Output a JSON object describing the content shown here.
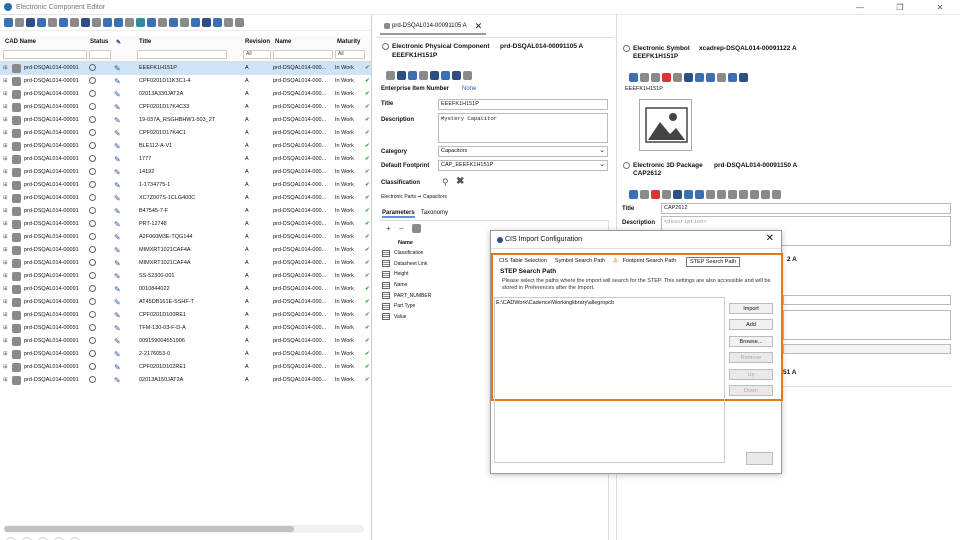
{
  "app": {
    "title": "Electronic Component Editor"
  },
  "left": {
    "columns": {
      "cad": "CAD Name",
      "status": "Status",
      "title": "Title",
      "revision": "Revision",
      "name": "Name",
      "maturity": "Maturity"
    },
    "filters": {
      "revision": "All",
      "maturity": "All"
    },
    "rows": [
      {
        "cad": "prd-DSQAL014-00091",
        "title": "EEEFK1H151P",
        "rev": "A",
        "name": "prd-DSQAL014-000...",
        "mat": "In Work"
      },
      {
        "cad": "prd-DSQAL014-00091",
        "title": "CPF0201D11K3C1-4",
        "rev": "A",
        "name": "prd-DSQAL014-000...",
        "mat": "In Work"
      },
      {
        "cad": "prd-DSQAL014-00091",
        "title": "02013A330JAT2A",
        "rev": "A",
        "name": "prd-DSQAL014-000...",
        "mat": "In Work"
      },
      {
        "cad": "prd-DSQAL014-00091",
        "title": "CPF0201D17K4C33",
        "rev": "A",
        "name": "prd-DSQAL014-000...",
        "mat": "In Work"
      },
      {
        "cad": "prd-DSQAL014-00091",
        "title": "19-037A_RSGHBHW1-503_2T",
        "rev": "A",
        "name": "prd-DSQAL014-000...",
        "mat": "In Work"
      },
      {
        "cad": "prd-DSQAL014-00091",
        "title": "CPF0201D17K4C1",
        "rev": "A",
        "name": "prd-DSQAL014-000...",
        "mat": "In Work"
      },
      {
        "cad": "prd-DSQAL014-00091",
        "title": "BLE112-A-V1",
        "rev": "A",
        "name": "prd-DSQAL014-000...",
        "mat": "In Work"
      },
      {
        "cad": "prd-DSQAL014-00091",
        "title": "1777",
        "rev": "A",
        "name": "prd-DSQAL014-000...",
        "mat": "In Work"
      },
      {
        "cad": "prd-DSQAL014-00091",
        "title": "14192",
        "rev": "A",
        "name": "prd-DSQAL014-000...",
        "mat": "In Work"
      },
      {
        "cad": "prd-DSQAL014-00091",
        "title": "1-1734775-1",
        "rev": "A",
        "name": "prd-DSQAL014-000...",
        "mat": "In Work"
      },
      {
        "cad": "prd-DSQAL014-00091",
        "title": "XC7Z007S-1CLG400C",
        "rev": "A",
        "name": "prd-DSQAL014-000...",
        "mat": "In Work"
      },
      {
        "cad": "prd-DSQAL014-00091",
        "title": "B47545-7-F",
        "rev": "A",
        "name": "prd-DSQAL014-000...",
        "mat": "In Work"
      },
      {
        "cad": "prd-DSQAL014-00091",
        "title": "PRT-12748",
        "rev": "A",
        "name": "prd-DSQAL014-000...",
        "mat": "In Work"
      },
      {
        "cad": "prd-DSQAL014-00091",
        "title": "A2F060M3E-TQG144",
        "rev": "A",
        "name": "prd-DSQAL014-000...",
        "mat": "In Work"
      },
      {
        "cad": "prd-DSQAL014-00091",
        "title": "MIMXRT1021CAF4A",
        "rev": "A",
        "name": "prd-DSQAL014-000...",
        "mat": "In Work"
      },
      {
        "cad": "prd-DSQAL014-00091",
        "title": "MIMXRT1021CAF4A",
        "rev": "A",
        "name": "prd-DSQAL014-000...",
        "mat": "In Work"
      },
      {
        "cad": "prd-DSQAL014-00091",
        "title": "SS-52300-001",
        "rev": "A",
        "name": "prd-DSQAL014-000...",
        "mat": "In Work"
      },
      {
        "cad": "prd-DSQAL014-00091",
        "title": "0010844022",
        "rev": "A",
        "name": "prd-DSQAL014-000...",
        "mat": "In Work"
      },
      {
        "cad": "prd-DSQAL014-00091",
        "title": "AT45DB161E-SSHF-T",
        "rev": "A",
        "name": "prd-DSQAL014-000...",
        "mat": "In Work"
      },
      {
        "cad": "prd-DSQAL014-00091",
        "title": "CPF0201D100RE1",
        "rev": "A",
        "name": "prd-DSQAL014-000...",
        "mat": "In Work"
      },
      {
        "cad": "prd-DSQAL014-00091",
        "title": "TFM-130-03-F-D-A",
        "rev": "A",
        "name": "prd-DSQAL014-000...",
        "mat": "In Work"
      },
      {
        "cad": "prd-DSQAL014-00091",
        "title": "009159004551906",
        "rev": "A",
        "name": "prd-DSQAL014-000...",
        "mat": "In Work"
      },
      {
        "cad": "prd-DSQAL014-00091",
        "title": "2-2176053-0",
        "rev": "A",
        "name": "prd-DSQAL014-000...",
        "mat": "In Work"
      },
      {
        "cad": "prd-DSQAL014-00091",
        "title": "CPF0201D102RE1",
        "rev": "A",
        "name": "prd-DSQAL014-000...",
        "mat": "In Work"
      },
      {
        "cad": "prd-DSQAL014-00091",
        "title": "02013A150JAT2A",
        "rev": "A",
        "name": "prd-DSQAL014-000...",
        "mat": "In Work"
      }
    ]
  },
  "mid": {
    "tab": "prd-DSQAL014-00091105 A",
    "header_type": "Electronic Physical Component",
    "header_id": "prd-DSQAL014-00091105 A",
    "header_sub": "EEEFK1H151P",
    "eii_label": "Enterprise Item Number",
    "eii_value": "None",
    "title_label": "Title",
    "title_value": "EEEFK1H151P",
    "desc_label": "Description",
    "desc_value": "Mystery Capacitor",
    "cat_label": "Category",
    "cat_value": "Capacitors",
    "fp_label": "Default Footprint",
    "fp_value": "CAP_EEEFK1H151P",
    "class_label": "Classification",
    "class_path": "Electronic Parts ➞ Capacitors",
    "ptabs": [
      "Parameters",
      "Taxonomy"
    ],
    "name_col": "Name",
    "params": [
      "Classification",
      "Datasheet Link",
      "Height",
      "Name",
      "PART_NUMBER",
      "Part Type",
      "Value"
    ]
  },
  "right": {
    "sym_type": "Electronic Symbol",
    "sym_id": "xcadrep-DSQAL014-00091122 A",
    "sym_sub": "EEEFK1H151P",
    "sym_name": "EEEFK1H151P",
    "pkg_type": "Electronic 3D Package",
    "pkg_id": "prd-DSQAL014-00091150 A",
    "pkg_sub": "CAP2612",
    "title_label": "Title",
    "title_value": "CAP2612",
    "desc_label": "Description",
    "desc_placeholder": "<description>",
    "frag1": "2 A",
    "frag2": "51 A"
  },
  "dialog": {
    "title": "CIS Import Configuration",
    "tabs": [
      "CIS Table Selection",
      "Symbol Search Path",
      "Footprint Search Path",
      "STEP Search Path"
    ],
    "heading": "STEP Search Path",
    "desc": "Please select the paths where the import will search for the STEP. This settings are also accessible and will be stored in Preferences after the Import.",
    "path": "E:\\CADWork\\Cadence\\Workinglibrary\\allegropcb",
    "buttons": [
      "Import",
      "Add",
      "Browse...",
      "Remove",
      "Up",
      "Down"
    ]
  }
}
